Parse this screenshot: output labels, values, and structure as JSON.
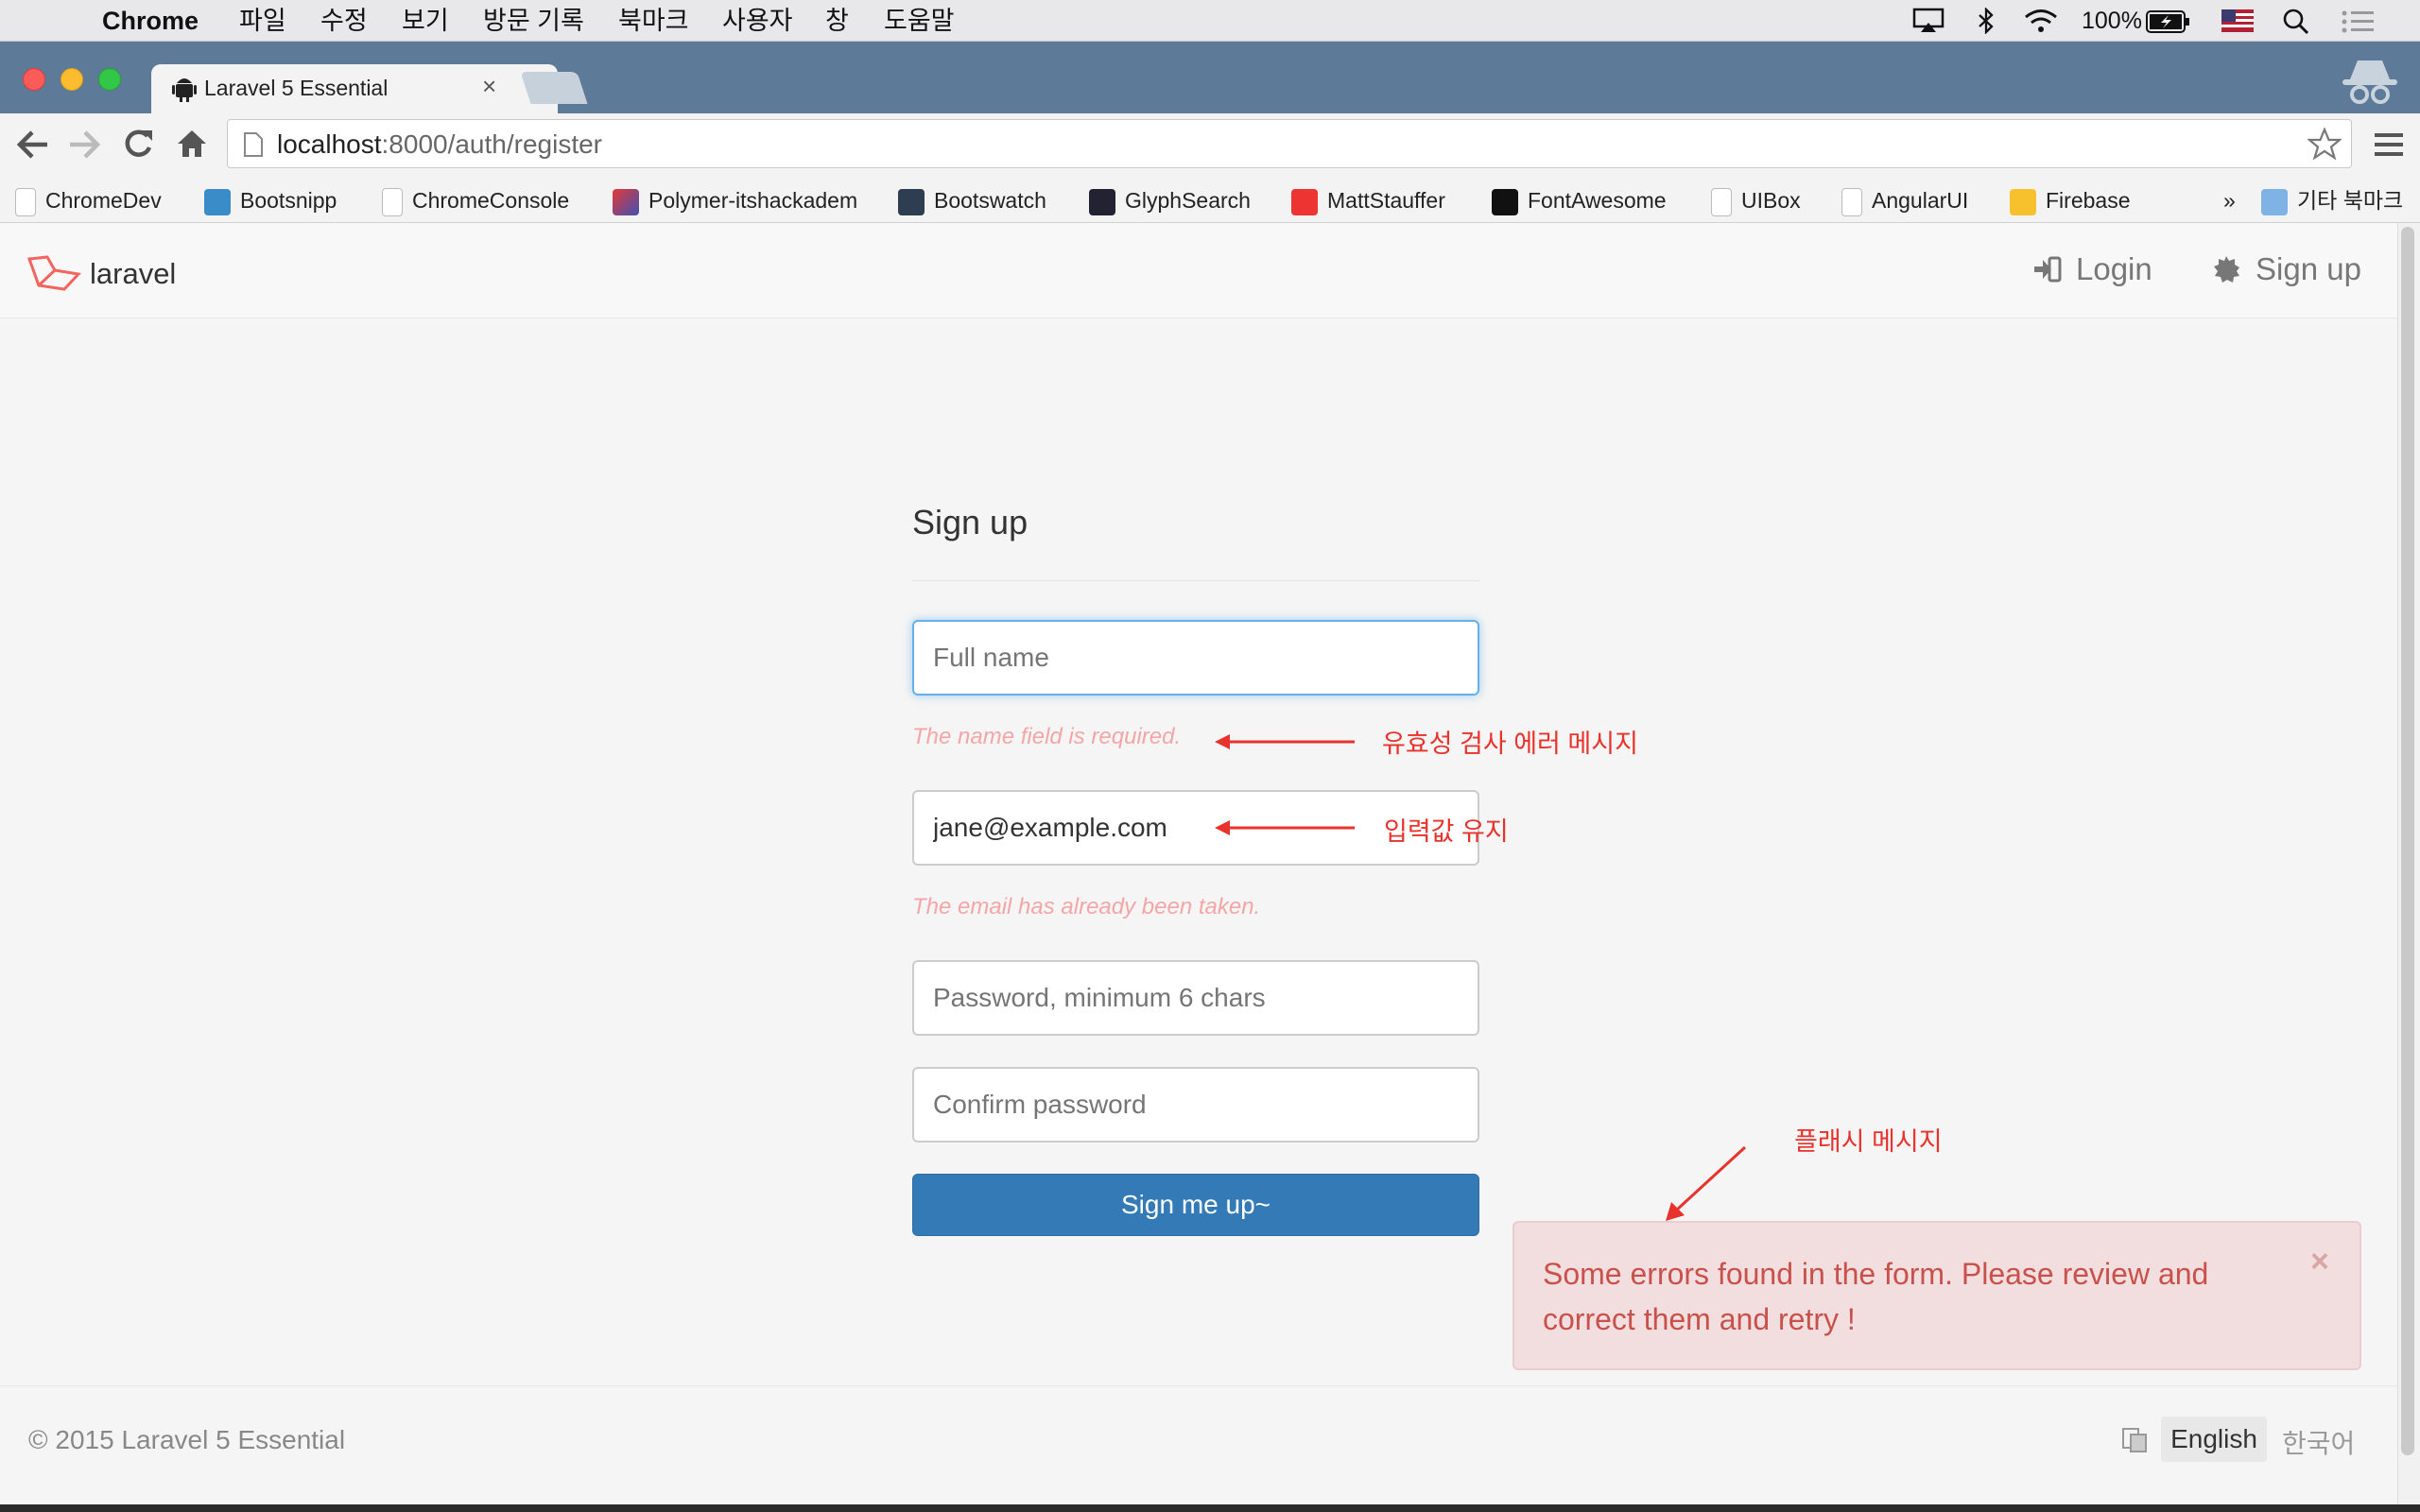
{
  "menubar": {
    "app_name": "Chrome",
    "items": [
      "파일",
      "수정",
      "보기",
      "방문 기록",
      "북마크",
      "사용자",
      "창",
      "도움말"
    ],
    "battery": "100%"
  },
  "browser": {
    "tab_title": "Laravel 5 Essential",
    "url_host": "localhost",
    "url_rest": ":8000/auth/register",
    "bookmarks": [
      "ChromeDev",
      "Bootsnipp",
      "ChromeConsole",
      "Polymer-itshackadem",
      "Bootswatch",
      "GlyphSearch",
      "MattStauffer",
      "FontAwesome",
      "UIBox",
      "AngularUI",
      "Firebase"
    ],
    "bookmarks_overflow": "»",
    "other_bookmarks": "기타 북마크"
  },
  "site": {
    "brand": "laravel",
    "nav_login": "Login",
    "nav_signup": "Sign up"
  },
  "form": {
    "title": "Sign up",
    "name_placeholder": "Full name",
    "name_error": "The name field is required.",
    "email_value": "jane@example.com",
    "email_error": "The email has already been taken.",
    "password_placeholder": "Password, minimum 6 chars",
    "confirm_placeholder": "Confirm password",
    "submit_label": "Sign me up~"
  },
  "annotations": {
    "validation": "유효성 검사 에러 메시지",
    "old_input": "입력값 유지",
    "flash": "플래시 메시지"
  },
  "flash": {
    "message": "Some errors found in the form. Please review and correct them and retry !",
    "close": "×"
  },
  "footer": {
    "copyright": "© 2015   Laravel 5 Essential",
    "lang_en": "English",
    "lang_ko": "한국어"
  },
  "colors": {
    "primary": "#337ab7",
    "error_text": "#f4a6a6",
    "annotation": "#e8322c",
    "alert_bg": "#f2dede"
  }
}
